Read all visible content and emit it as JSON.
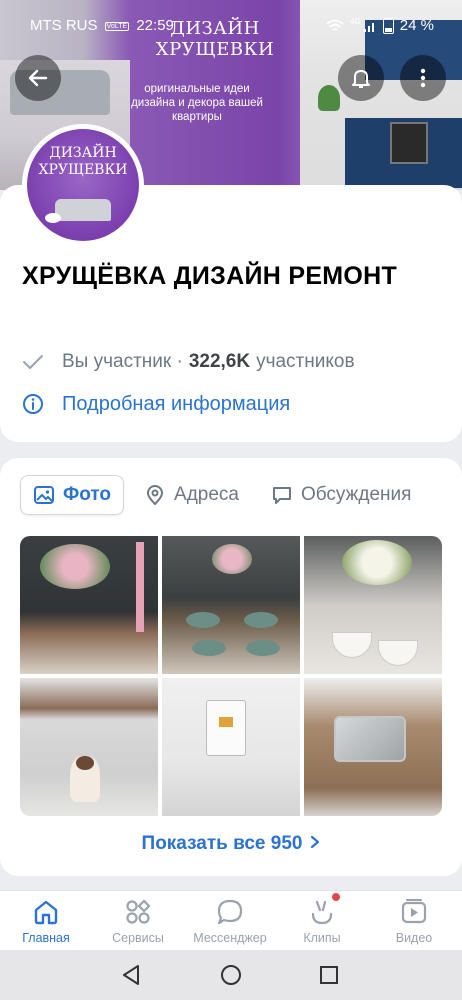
{
  "status_bar": {
    "carrier": "MTS RUS",
    "volte": "VoLTE",
    "time": "22:59",
    "network": "4G",
    "battery": "24 %"
  },
  "cover": {
    "title": "ДИЗАЙН ХРУЩЕВКИ",
    "subtitle": "оригинальные идеи дизайна и декора вашей квартиры"
  },
  "avatar": {
    "text": "ДИЗАЙН ХРУЩЕВКИ"
  },
  "group": {
    "name": "ХРУЩЁВКА ДИЗАЙН РЕМОНТ",
    "membership": "Вы участник ·",
    "members_count": "322,6K",
    "members_label": "участников",
    "info_link": "Подробная информация"
  },
  "tabs": [
    {
      "label": "Фото",
      "icon": "photo-icon",
      "active": true
    },
    {
      "label": "Адреса",
      "icon": "location-pin-icon",
      "active": false
    },
    {
      "label": "Обсуждения",
      "icon": "chat-bubble-icon",
      "active": false
    }
  ],
  "photos_show_all": "Показать все 950",
  "bottom_nav": [
    {
      "label": "Главная",
      "icon": "home-icon",
      "active": true
    },
    {
      "label": "Сервисы",
      "icon": "services-icon",
      "active": false
    },
    {
      "label": "Мессенджер",
      "icon": "messenger-icon",
      "active": false
    },
    {
      "label": "Клипы",
      "icon": "clips-icon",
      "active": false
    },
    {
      "label": "Видео",
      "icon": "video-icon",
      "active": false
    }
  ],
  "colors": {
    "accent": "#2a73d1",
    "muted": "#6d7885",
    "badge": "#e64646"
  }
}
